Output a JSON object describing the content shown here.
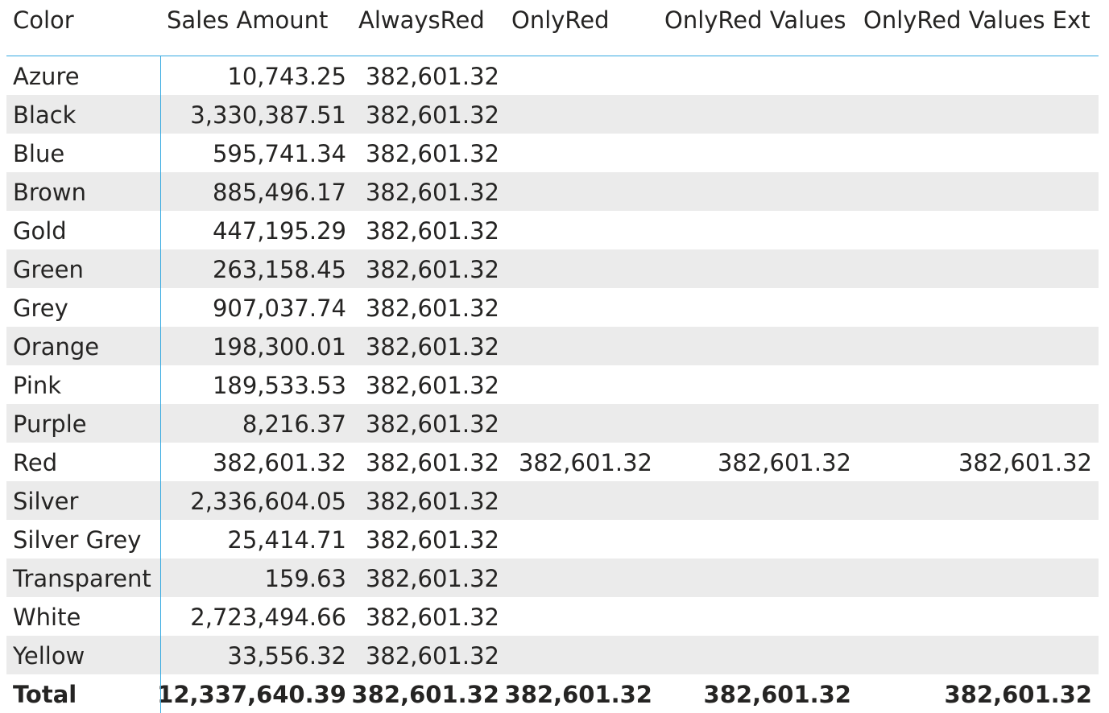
{
  "table": {
    "headers": [
      "Color",
      "Sales Amount",
      "AlwaysRed",
      "OnlyRed",
      "OnlyRed Values",
      "OnlyRed Values Ext"
    ],
    "rows": [
      [
        "Azure",
        "10,743.25",
        "382,601.32",
        "",
        "",
        ""
      ],
      [
        "Black",
        "3,330,387.51",
        "382,601.32",
        "",
        "",
        ""
      ],
      [
        "Blue",
        "595,741.34",
        "382,601.32",
        "",
        "",
        ""
      ],
      [
        "Brown",
        "885,496.17",
        "382,601.32",
        "",
        "",
        ""
      ],
      [
        "Gold",
        "447,195.29",
        "382,601.32",
        "",
        "",
        ""
      ],
      [
        "Green",
        "263,158.45",
        "382,601.32",
        "",
        "",
        ""
      ],
      [
        "Grey",
        "907,037.74",
        "382,601.32",
        "",
        "",
        ""
      ],
      [
        "Orange",
        "198,300.01",
        "382,601.32",
        "",
        "",
        ""
      ],
      [
        "Pink",
        "189,533.53",
        "382,601.32",
        "",
        "",
        ""
      ],
      [
        "Purple",
        "8,216.37",
        "382,601.32",
        "",
        "",
        ""
      ],
      [
        "Red",
        "382,601.32",
        "382,601.32",
        "382,601.32",
        "382,601.32",
        "382,601.32"
      ],
      [
        "Silver",
        "2,336,604.05",
        "382,601.32",
        "",
        "",
        ""
      ],
      [
        "Silver Grey",
        "25,414.71",
        "382,601.32",
        "",
        "",
        ""
      ],
      [
        "Transparent",
        "159.63",
        "382,601.32",
        "",
        "",
        ""
      ],
      [
        "White",
        "2,723,494.66",
        "382,601.32",
        "",
        "",
        ""
      ],
      [
        "Yellow",
        "33,556.32",
        "382,601.32",
        "",
        "",
        ""
      ]
    ],
    "total": [
      "Total",
      "12,337,640.39",
      "382,601.32",
      "382,601.32",
      "382,601.32",
      "382,601.32"
    ]
  },
  "colors": {
    "row_stripe": "#ebebeb",
    "accent_line": "#33a8e0",
    "text": "#252423"
  }
}
